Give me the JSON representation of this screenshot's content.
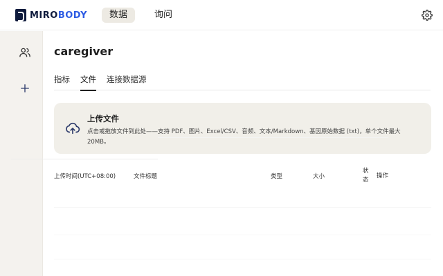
{
  "brand": {
    "part1": "MIRO",
    "part2": "BODY"
  },
  "nav": {
    "tabs": [
      {
        "label": "数据",
        "active": true
      },
      {
        "label": "询问",
        "active": false
      }
    ]
  },
  "icons": {
    "settings": "gear-icon",
    "sidebar_users": "users-icon",
    "sidebar_add": "plus-icon",
    "upload": "cloud-upload-icon"
  },
  "colors": {
    "brand_dark": "#0e1a3c",
    "brand_blue": "#2d5be3",
    "sidebar_bg": "#f4f2ee",
    "upload_bg": "#f1efe9",
    "active_tab_bg": "#edeae3"
  },
  "page": {
    "title": "caregiver",
    "tabs": [
      {
        "label": "指标",
        "active": false
      },
      {
        "label": "文件",
        "active": true
      },
      {
        "label": "连接数据源",
        "active": false
      }
    ]
  },
  "upload": {
    "title": "上传文件",
    "description": "点击或拖放文件到此处——支持 PDF、图片、Excel/CSV、音频、文本/Markdown、基因原始数据 (txt)，单个文件最大 20MB。"
  },
  "table": {
    "headers": {
      "time": "上传时间(UTC+08:00)",
      "title": "文件标题",
      "type": "类型",
      "size": "大小",
      "status": "状态",
      "ops": "操作"
    }
  }
}
